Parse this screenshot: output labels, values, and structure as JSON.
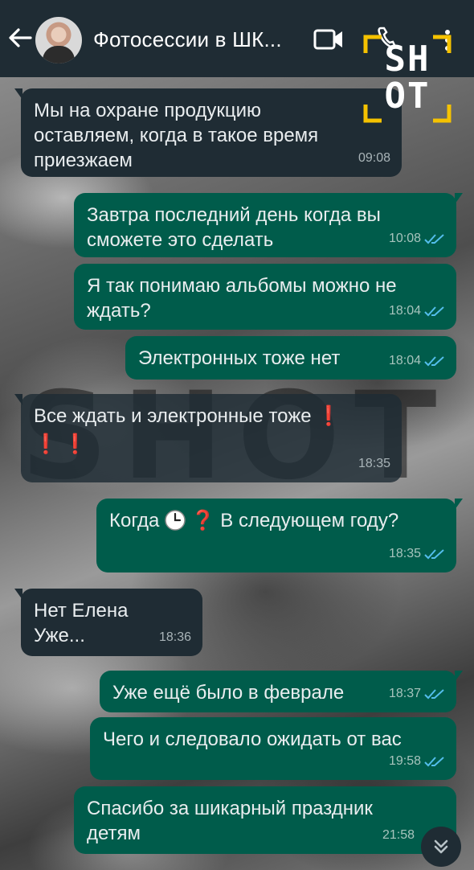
{
  "header": {
    "title": "Фотосессии в ШК...",
    "icons": [
      "back-arrow-icon",
      "avatar",
      "video-call-icon",
      "voice-call-icon",
      "more-menu-icon"
    ]
  },
  "watermark": {
    "logo_line1": "SH",
    "logo_line2": "OT",
    "center_text": "SHOT",
    "logo_color": "#f5c200"
  },
  "messages": [
    {
      "direction": "in",
      "lines": [
        "Мы на охране продукцию",
        "оставляем, когда в такое время",
        "приезжаем"
      ],
      "time": "09:08"
    },
    {
      "direction": "out",
      "lines": [
        "Завтра последний день когда вы",
        "сможете это сделать"
      ],
      "time": "10:08",
      "read": true
    },
    {
      "direction": "out",
      "lines": [
        "Я так понимаю альбомы можно не",
        "ждать?"
      ],
      "time": "18:04",
      "read": true
    },
    {
      "direction": "out",
      "lines": [
        "Электронных тоже нет"
      ],
      "time": "18:04",
      "read": true
    },
    {
      "direction": "in",
      "lines": [
        "Все ждать и электронные тоже"
      ],
      "emoji_after_line1": "❗",
      "emoji_line2": "❗ ❗",
      "time": "18:35"
    },
    {
      "direction": "out",
      "text_before_emoji": "Когда",
      "emoji_question": "❓",
      "text_after_emoji": "В следующем году?",
      "emoji_clock": "clock-emoji-icon",
      "time": "18:35",
      "read": true
    },
    {
      "direction": "in",
      "lines": [
        "Нет Елена",
        "Уже..."
      ],
      "time": "18:36"
    },
    {
      "direction": "out",
      "lines": [
        "Уже ещё было в феврале"
      ],
      "time": "18:37",
      "read": true
    },
    {
      "direction": "out",
      "lines": [
        "Чего и следовало ожидать от вас"
      ],
      "time": "19:58",
      "read": true
    },
    {
      "direction": "out",
      "lines": [
        "Спасибо за шикарный праздник",
        "детям"
      ],
      "time": "21:58",
      "read": false
    }
  ],
  "colors": {
    "header_bg": "#1f2c34",
    "incoming_bubble": "#1f2c34",
    "outgoing_bubble": "#005c4b",
    "read_ticks": "#53bdeb"
  }
}
